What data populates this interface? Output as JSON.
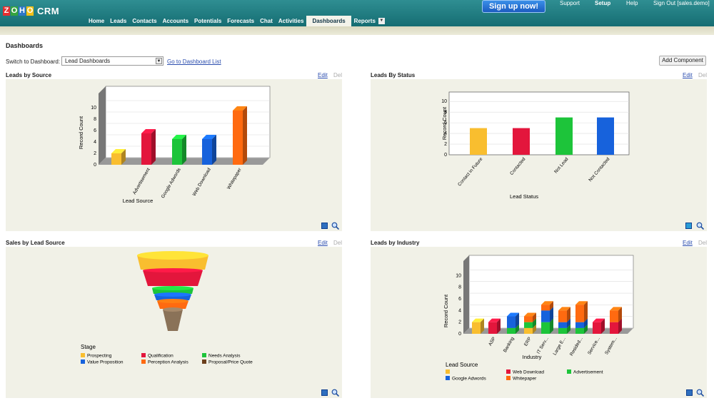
{
  "header": {
    "logo_letters": [
      "Z",
      "O",
      "H",
      "O"
    ],
    "logo_colors": [
      "#e42f2f",
      "#35a33f",
      "#2e77c9",
      "#f4c018"
    ],
    "product": "CRM",
    "signup": "Sign up now!",
    "links": {
      "support": "Support",
      "setup": "Setup",
      "help": "Help",
      "signout": "Sign Out [sales.demo]"
    },
    "tabs": [
      "Home",
      "Leads",
      "Contacts",
      "Accounts",
      "Potentials",
      "Forecasts",
      "Chat",
      "Activities",
      "Dashboards",
      "Reports"
    ],
    "active_tab": "Dashboards"
  },
  "page": {
    "title": "Dashboards",
    "switch_label": "Switch to Dashboard:",
    "switch_value": "Lead Dashboards",
    "go_link": "Go to Dashboard List",
    "add_component": "Add Component"
  },
  "edit_label": "Edit",
  "del_label": "Del",
  "panels": {
    "p1": {
      "title": "Leads by Source"
    },
    "p2": {
      "title": "Leads By Status"
    },
    "p3": {
      "title": "Sales by Lead Source"
    },
    "p4": {
      "title": "Leads by Industry"
    }
  },
  "colors": {
    "yellow": "#f9be2f",
    "red": "#e3163c",
    "green": "#1dc43a",
    "blue": "#1762dc",
    "orange": "#ff6a10",
    "brown": "#6b3f1c"
  },
  "chart_data": [
    {
      "type": "bar",
      "title": "Leads by Source",
      "xlabel": "Lead Source",
      "ylabel": "Record Count",
      "ylim": [
        0,
        10
      ],
      "categories": [
        "Advertisement",
        "Google Adwords",
        "Web Download",
        "Whitepaper"
      ],
      "pre_categories": [
        ""
      ],
      "values": [
        2,
        5.5,
        4.5,
        4.5,
        9.5
      ],
      "labels": [
        "",
        "Advertisement",
        "Google Adwords",
        "Web Download",
        "Whitepaper"
      ],
      "bar_colors": [
        "#f9be2f",
        "#e3163c",
        "#1dc43a",
        "#1762dc",
        "#ff6a10"
      ],
      "yticks": [
        0,
        2,
        4,
        6,
        8,
        10
      ]
    },
    {
      "type": "bar",
      "title": "Leads By Status",
      "xlabel": "Lead Status",
      "ylabel": "Record Count",
      "ylim": [
        0,
        10
      ],
      "categories": [
        "Contact in Future",
        "Contacted",
        "Not Lead",
        "Not Contacted"
      ],
      "values": [
        5,
        5,
        7,
        7
      ],
      "bar_colors": [
        "#f9be2f",
        "#e3163c",
        "#1dc43a",
        "#1762dc"
      ],
      "yticks": [
        0,
        2,
        4,
        6,
        8,
        10
      ]
    },
    {
      "type": "funnel",
      "title": "Sales by Lead Source",
      "legend_title": "Stage",
      "stages": [
        "Prospecting",
        "Qualification",
        "Needs Analysis",
        "Value Proposition",
        "Perception Analysis",
        "Proposal/Price Quote"
      ],
      "stage_colors": [
        "#f9be2f",
        "#e3163c",
        "#1dc43a",
        "#1762dc",
        "#ff6a10",
        "#6b3f1c"
      ]
    },
    {
      "type": "stacked-bar",
      "title": "Leads by Industry",
      "xlabel": "Industry",
      "ylabel": "Record Count",
      "ylim": [
        0,
        10
      ],
      "legend_title": "Lead Source",
      "categories": [
        "",
        "ASP",
        "Banking",
        "ERP",
        "IT Serv...",
        "Large E...",
        "Resided...",
        "Service...",
        "System..."
      ],
      "series": [
        {
          "name": "",
          "values": [
            2,
            0,
            0,
            1,
            0,
            0,
            0,
            0,
            0
          ]
        },
        {
          "name": "Web Download",
          "values": [
            0,
            2,
            0,
            0,
            0,
            0,
            0,
            2,
            2
          ]
        },
        {
          "name": "Advertisement",
          "values": [
            0,
            0,
            1,
            1,
            2,
            1,
            1,
            0,
            0
          ]
        },
        {
          "name": "Google Adwords",
          "values": [
            0,
            0,
            2,
            0,
            2,
            1,
            1,
            0,
            0
          ]
        },
        {
          "name": "Whitepaper",
          "values": [
            0,
            0,
            0,
            1,
            1,
            2,
            3,
            0,
            2
          ]
        }
      ],
      "series_colors": [
        "#f9be2f",
        "#e3163c",
        "#1dc43a",
        "#1762dc",
        "#ff6a10"
      ],
      "legend_order": [
        0,
        1,
        2,
        3,
        4
      ],
      "yticks": [
        0,
        2,
        4,
        6,
        8,
        10
      ]
    }
  ]
}
